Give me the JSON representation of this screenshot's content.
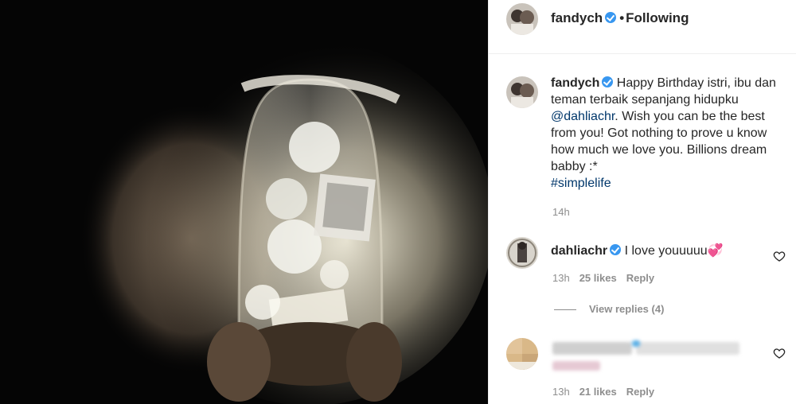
{
  "post": {
    "username": "fandych",
    "follow_status": "Following",
    "separator": "•"
  },
  "caption": {
    "username": "fandych",
    "text_1": "Happy Birthday istri, ibu dan teman terbaik sepanjang hidupku",
    "mention": "@dahliachr",
    "text_2": ". Wish you can be the best from you! Got nothing to prove u know how much we love you. Billions dream babby :*",
    "hashtag": "#simplelife",
    "time": "14h"
  },
  "comments": [
    {
      "username": "dahliachr",
      "text": "I love youuuuu",
      "emoji": "💞",
      "time": "13h",
      "likes": "25 likes",
      "reply": "Reply",
      "view_replies": "View replies (4)"
    },
    {
      "time": "13h",
      "likes": "21 likes",
      "reply": "Reply"
    }
  ],
  "colors": {
    "verified": "#3897f0",
    "link": "#00376b",
    "muted": "#8e8e8e",
    "heart_emoji": "#e0245e"
  },
  "icons": {
    "verified": "verified-badge-icon",
    "like": "heart-outline-icon"
  }
}
